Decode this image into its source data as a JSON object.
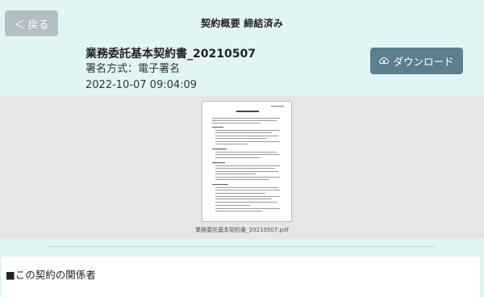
{
  "header": {
    "back_label": "＜ 戻る",
    "title": "契約概要 締結済み"
  },
  "document": {
    "name": "業務委託基本契約書_20210507",
    "method": "署名方式：電子署名",
    "date": "2022-10-07 09:04:09",
    "download_label": "ダウンロード",
    "file_name": "業務委託基本契約書_20210507.pdf"
  },
  "parties": {
    "title": "■この契約の関係者"
  },
  "colors": {
    "background": "#e2f5f5",
    "back_button": "#b4bfc5",
    "download_button": "#5a7f8e",
    "preview_bg": "#e6e6e6"
  }
}
